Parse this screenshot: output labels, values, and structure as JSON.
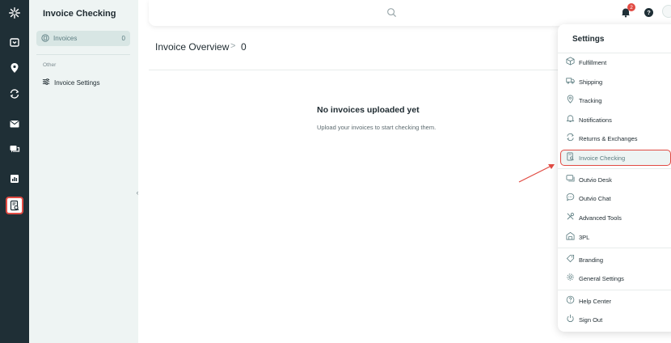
{
  "colors": {
    "rail": "#1f2f36",
    "sidebar": "#eef4f3",
    "accent": "#e14b43",
    "muted_teal": "#5b7c80"
  },
  "sidebar": {
    "title": "Invoice Checking",
    "active_item": {
      "label": "Invoices",
      "count": "0",
      "icon": "invoice-icon"
    },
    "section_label": "Other",
    "items": [
      {
        "label": "Invoice Settings",
        "icon": "sliders-icon"
      }
    ]
  },
  "rail": {
    "icons": [
      "logo-icon",
      "package-icon",
      "location-pin-icon",
      "refresh-icon",
      "mail-icon",
      "chat-icon",
      "chart-icon",
      "invoice-check-icon"
    ],
    "active": "invoice-check-icon"
  },
  "topbar": {
    "notification_count": "2",
    "help_label": "?"
  },
  "main": {
    "title": "Invoice Overview",
    "separator": ">",
    "count": "0",
    "empty_title": "No invoices uploaded yet",
    "empty_subtitle": "Upload your invoices to start checking them."
  },
  "settings_menu": {
    "title": "Settings",
    "items": [
      {
        "label": "Fulfillment",
        "icon": "box-icon"
      },
      {
        "label": "Shipping",
        "icon": "truck-icon"
      },
      {
        "label": "Tracking",
        "icon": "location-pin-icon"
      },
      {
        "label": "Notifications",
        "icon": "bell-icon"
      },
      {
        "label": "Returns & Exchanges",
        "icon": "refresh-icon"
      },
      {
        "label": "Invoice Checking",
        "icon": "invoice-check-icon",
        "highlighted": true
      },
      {
        "label": "Outvio Desk",
        "icon": "desk-icon"
      },
      {
        "label": "Outvio Chat",
        "icon": "chat-bubble-icon"
      },
      {
        "label": "Advanced Tools",
        "icon": "tools-icon"
      },
      {
        "label": "3PL",
        "icon": "warehouse-icon"
      },
      {
        "label": "Branding",
        "icon": "tag-icon"
      },
      {
        "label": "General Settings",
        "icon": "gear-icon"
      },
      {
        "label": "Help Center",
        "icon": "help-circle-icon"
      },
      {
        "label": "Sign Out",
        "icon": "power-icon"
      }
    ]
  }
}
